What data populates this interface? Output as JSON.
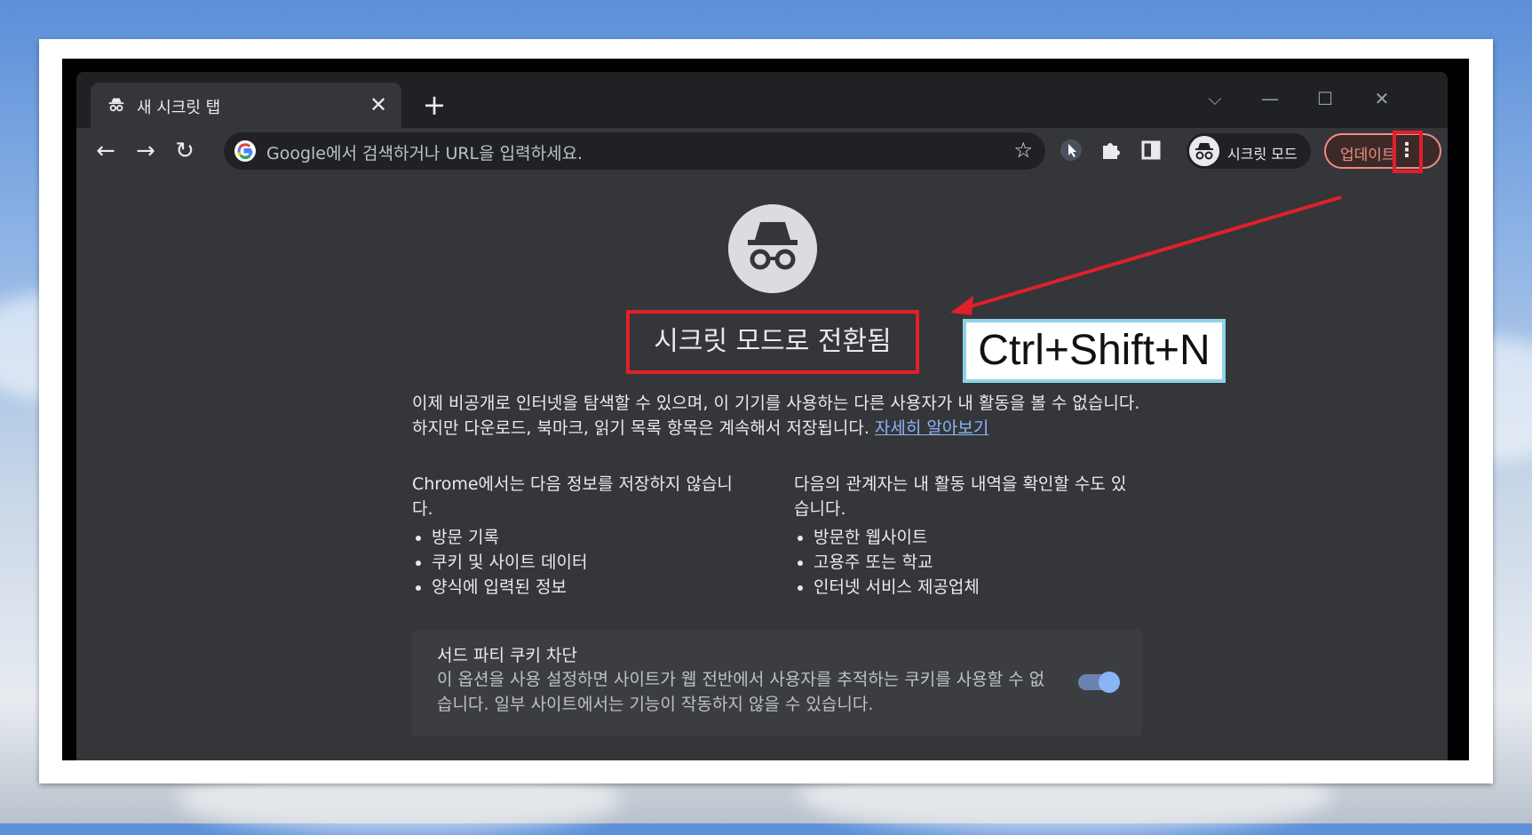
{
  "tab": {
    "title": "새 시크릿 탭",
    "close": "✕",
    "new_tab": "+"
  },
  "window_controls": {
    "dropdown": "⌵",
    "minimize": "—",
    "maximize": "☐",
    "close": "✕"
  },
  "toolbar": {
    "back": "←",
    "forward": "→",
    "reload": "↻",
    "omnibox_placeholder": "Google에서 검색하거나 URL을 입력하세요.",
    "bookmark_star": "☆",
    "profile_label": "시크릿 모드",
    "update_label": "업데이트",
    "menu": "⋮"
  },
  "content": {
    "headline": "시크릿 모드로 전환됨",
    "shortcut_annotation": "Ctrl+Shift+N",
    "intro": "이제 비공개로 인터넷을 탐색할 수 있으며, 이 기기를 사용하는 다른 사용자가 내 활동을 볼 수 없습니다. 하지만 다운로드, 북마크, 읽기 목록 항목은 계속해서 저장됩니다. ",
    "learn_more": "자세히 알아보기",
    "left_col_heading": "Chrome에서는 다음 정보를 저장하지 않습니다.",
    "left_col_items": [
      "방문 기록",
      "쿠키 및 사이트 데이터",
      "양식에 입력된 정보"
    ],
    "right_col_heading": "다음의 관계자는 내 활동 내역을 확인할 수도 있습니다.",
    "right_col_items": [
      "방문한 웹사이트",
      "고용주 또는 학교",
      "인터넷 서비스 제공업체"
    ],
    "cookie_title": "서드 파티 쿠키 차단",
    "cookie_desc": "이 옵션을 사용 설정하면 사이트가 웹 전반에서 사용자를 추적하는 쿠키를 사용할 수 없습니다. 일부 사이트에서는 기능이 작동하지 않을 수 있습니다.",
    "cookie_toggle_on": true
  },
  "colors": {
    "annotation_red": "#e0202a",
    "annotation_cyan": "#8dd3e8",
    "link": "#8ab4f8"
  }
}
